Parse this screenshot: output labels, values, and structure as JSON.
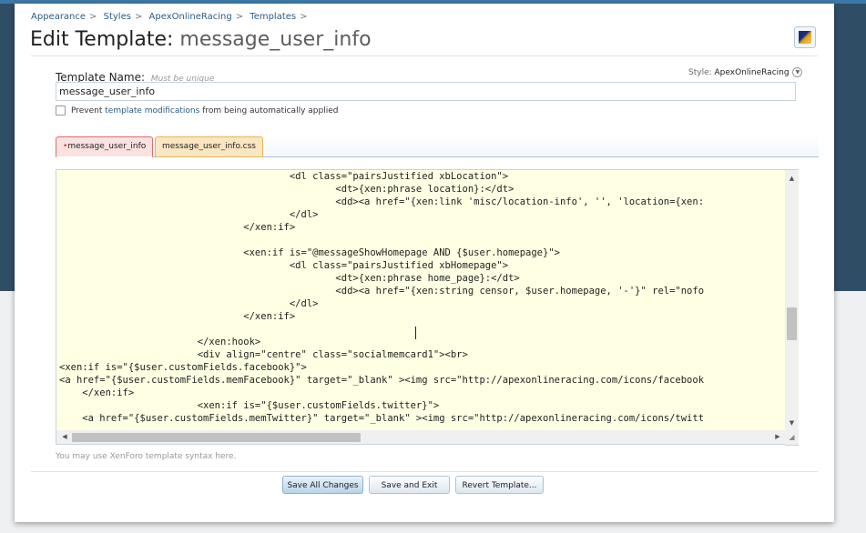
{
  "breadcrumb": [
    "Appearance",
    "Styles",
    "ApexOnlineRacing",
    "Templates"
  ],
  "breadcrumb_sep": ">",
  "page_title": {
    "prefix": "Edit Template:",
    "name": "message_user_info"
  },
  "template_name": {
    "label": "Template Name:",
    "hint": "Must be unique",
    "value": "message_user_info"
  },
  "style_selector": {
    "label": "Style:",
    "value": "ApexOnlineRacing"
  },
  "prevent_checkbox": {
    "before": "Prevent",
    "link": "template modifications",
    "after": "from being automatically applied",
    "checked": false
  },
  "tabs": [
    {
      "label": "message_user_info",
      "modified_marker": "•",
      "active": true
    },
    {
      "label": "message_user_info.css",
      "active": false
    }
  ],
  "editor": {
    "lines": [
      "                                        <dl class=\"pairsJustified xbLocation\">",
      "                                                <dt>{xen:phrase location}:</dt>",
      "                                                <dd><a href=\"{xen:link 'misc/location-info', '', 'location={xen:",
      "                                        </dl>",
      "                                </xen:if>",
      "",
      "                                <xen:if is=\"@messageShowHomepage AND {$user.homepage}\">",
      "                                        <dl class=\"pairsJustified xbHomepage\">",
      "                                                <dt>{xen:phrase home_page}:</dt>",
      "                                                <dd><a href=\"{xen:string censor, $user.homepage, '-'}\" rel=\"nofo",
      "                                        </dl>",
      "                                </xen:if>",
      "",
      "                        </xen:hook>",
      "                        <div align=\"centre\" class=\"socialmemcard1\"><br>",
      "<xen:if is=\"{$user.customFields.facebook}\">",
      "<a href=\"{$user.customFields.memFacebook}\" target=\"_blank\" ><img src=\"http://apexonlineracing.com/icons/facebook",
      "    </xen:if>",
      "                        <xen:if is=\"{$user.customFields.twitter}\">",
      "    <a href=\"{$user.customFields.memTwitter}\" target=\"_blank\" ><img src=\"http://apexonlineracing.com/icons/twitt"
    ]
  },
  "help_text": "You may use XenForo template syntax here.",
  "buttons": {
    "save_all": "Save All Changes",
    "save_exit": "Save and Exit",
    "revert": "Revert Template..."
  },
  "icons": {
    "color_palette": "color-palette-icon",
    "scroll_up": "arrow-up-icon",
    "scroll_down": "arrow-down-icon",
    "scroll_left": "arrow-left-icon",
    "scroll_right": "arrow-right-icon",
    "style_menu": "chevron-down-icon"
  },
  "colors": {
    "link": "#2b5b86",
    "active_tab_border": "#e06b6b",
    "other_tab_border": "#e7b45a",
    "editor_bg": "#ffffe3"
  }
}
